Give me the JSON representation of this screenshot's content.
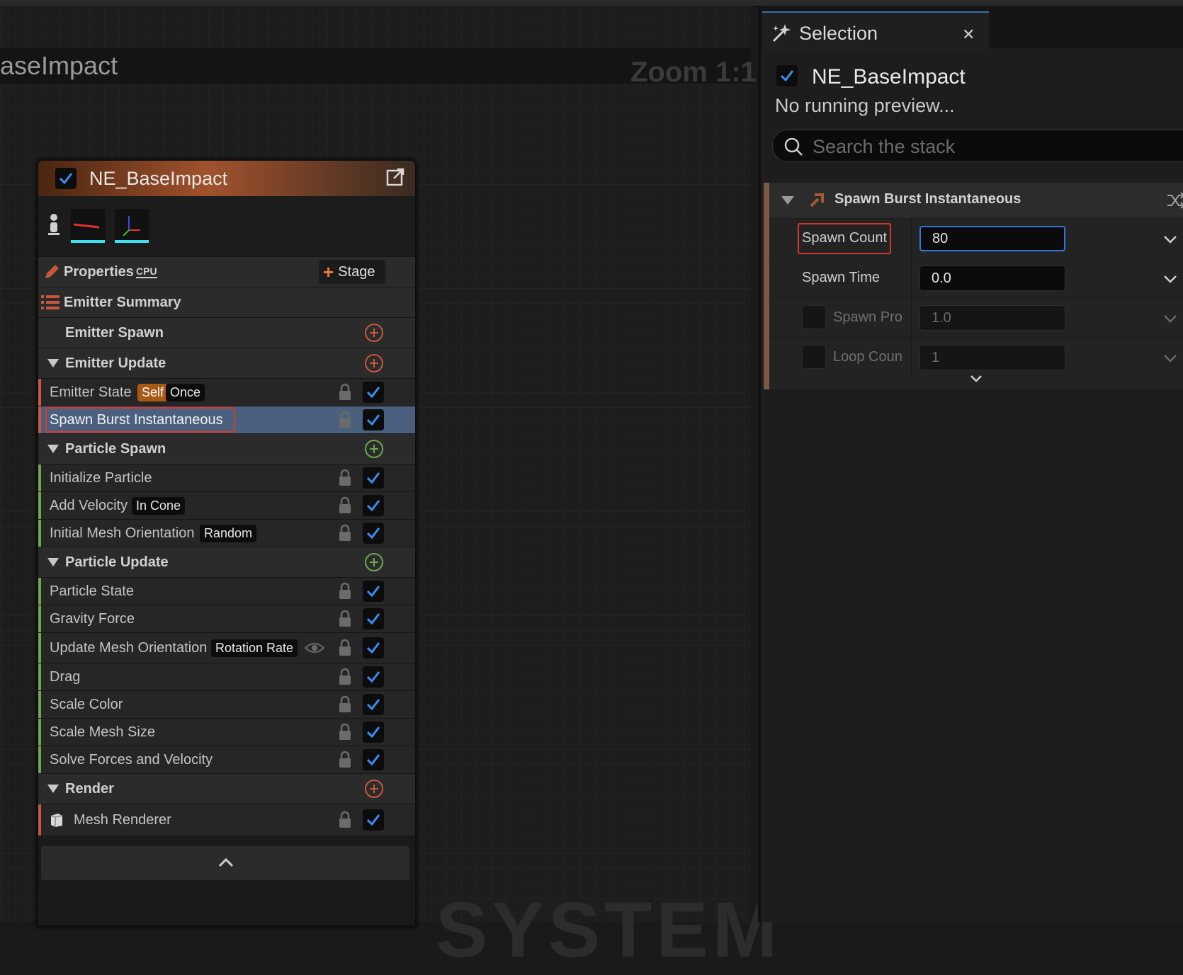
{
  "graph": {
    "title": "aseImpact",
    "zoom": "Zoom 1:1",
    "watermark": "SYSTEM"
  },
  "emitter": {
    "name": "NE_BaseImpact",
    "properties_label": "Properties",
    "cpu_label": "CPU",
    "stage_label": "Stage",
    "summary_label": "Emitter Summary",
    "sections": {
      "emitter_spawn": "Emitter Spawn",
      "emitter_update": "Emitter Update",
      "particle_spawn": "Particle Spawn",
      "particle_update": "Particle Update",
      "render": "Render"
    },
    "modules": {
      "emitter_state": {
        "label": "Emitter State",
        "tag1": "Self",
        "tag2": "Once"
      },
      "spawn_burst": {
        "label": "Spawn Burst Instantaneous"
      },
      "initialize_particle": {
        "label": "Initialize Particle"
      },
      "add_velocity": {
        "label": "Add Velocity",
        "tag": "In Cone"
      },
      "initial_mesh_orientation": {
        "label": "Initial Mesh Orientation",
        "tag": "Random"
      },
      "particle_state": {
        "label": "Particle State"
      },
      "gravity_force": {
        "label": "Gravity Force"
      },
      "update_mesh_orientation": {
        "label": "Update Mesh Orientation",
        "tag": "Rotation Rate"
      },
      "drag": {
        "label": "Drag"
      },
      "scale_color": {
        "label": "Scale Color"
      },
      "scale_mesh_size": {
        "label": "Scale Mesh Size"
      },
      "solve_forces": {
        "label": "Solve Forces and Velocity"
      },
      "mesh_renderer": {
        "label": "Mesh Renderer"
      }
    }
  },
  "selection": {
    "tab_title": "Selection",
    "name": "NE_BaseImpact",
    "status": "No running preview...",
    "search_placeholder": "Search the stack",
    "module_title": "Spawn Burst Instantaneous",
    "params": [
      {
        "name": "Spawn Count",
        "value": "80"
      },
      {
        "name": "Spawn Time",
        "value": "0.0"
      },
      {
        "name": "Spawn Pro",
        "value": "1.0"
      },
      {
        "name": "Loop Coun",
        "value": "1"
      }
    ]
  },
  "colors": {
    "accent_blue": "#2f78d8",
    "emitter_orange": "#a0522d",
    "highlight_red": "#d63a2a",
    "spawn_green": "#6aa84f",
    "update_orange": "#c8583c"
  }
}
